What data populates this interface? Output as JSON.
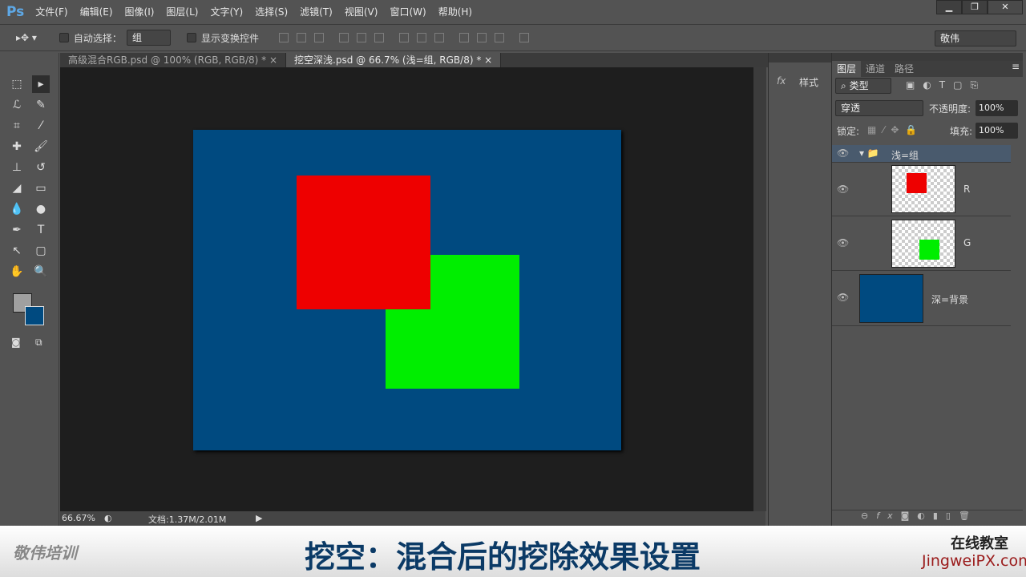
{
  "app": {
    "logo": "Ps"
  },
  "menu": [
    "文件(F)",
    "编辑(E)",
    "图像(I)",
    "图层(L)",
    "文字(Y)",
    "选择(S)",
    "滤镜(T)",
    "视图(V)",
    "窗口(W)",
    "帮助(H)"
  ],
  "window_controls": {
    "minimize": "▁",
    "restore": "❐",
    "close": "✕"
  },
  "options": {
    "auto_select_label": "自动选择：",
    "auto_select_value": "组",
    "show_transform_label": "显示变换控件",
    "workspace": "敬伟"
  },
  "tabs": [
    {
      "label": "高级混合RGB.psd @ 100% (RGB, RGB/8) *",
      "close": "×"
    },
    {
      "label": "挖空深浅.psd @ 66.7% (浅=组, RGB/8) *",
      "close": "×"
    }
  ],
  "colors": {
    "foreground": "#a0a0a0",
    "background": "#004a80",
    "doc_bg": "#004a80",
    "red": "#ee0000",
    "green": "#00ee00"
  },
  "status": {
    "zoom": "66.67%",
    "doc": "文档:1.37M/2.01M"
  },
  "styles_panel": {
    "label": "样式"
  },
  "layers_panel": {
    "tabs": [
      "图层",
      "通道",
      "路径"
    ],
    "filter": "类型",
    "blend_mode": "穿透",
    "opacity_label": "不透明度:",
    "opacity": "100%",
    "lock_label": "锁定:",
    "fill_label": "填充:",
    "fill": "100%",
    "layers": [
      {
        "name": "浅=组"
      },
      {
        "name": "R"
      },
      {
        "name": "G"
      },
      {
        "name": "深=背景"
      }
    ]
  },
  "banner": {
    "brand": "敬伟培训",
    "title": "挖空：混合后的挖除效果设置",
    "right_top": "在线教室",
    "right_bottom": "JingweiPX.com"
  }
}
